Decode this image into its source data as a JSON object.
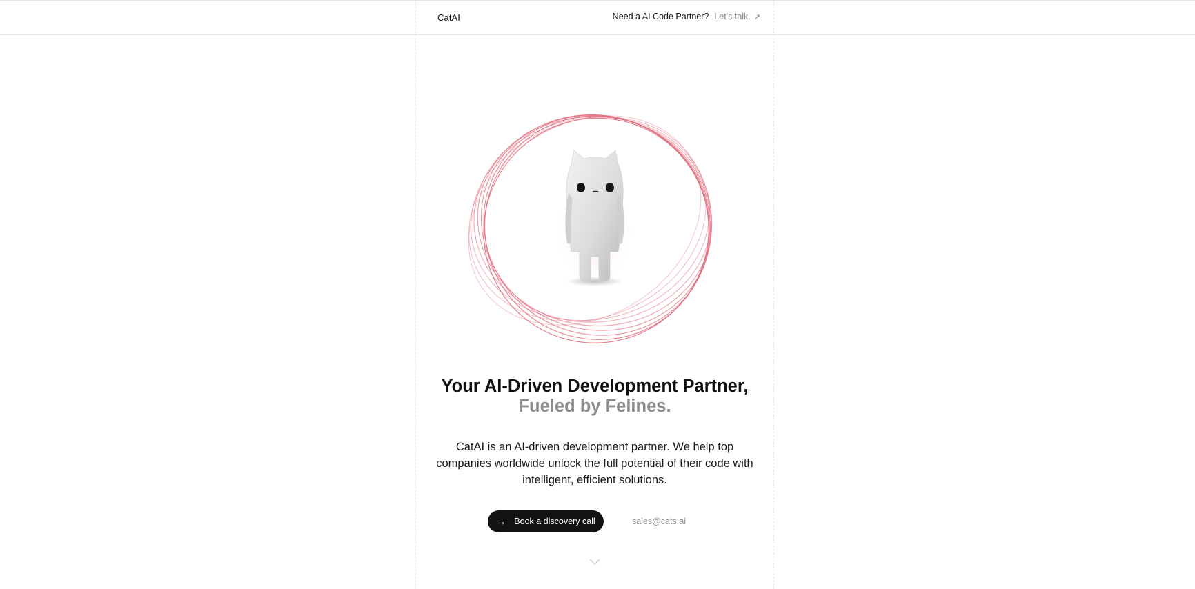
{
  "header": {
    "brand": "CatAI",
    "partner_question": "Need a AI Code Partner?",
    "partner_link": "Let's talk."
  },
  "hero": {
    "headline_main": "Your AI-Driven Development Partner,",
    "headline_accent": "Fueled by Felines.",
    "description": "CatAI is an AI-driven development partner. We help top companies worldwide unlock the full potential of their code with intelligent, efficient solutions.",
    "cta_label": "Book a discovery call",
    "cta_icon": "arrow-right-icon",
    "email": "sales@cats.ai"
  },
  "icons": {
    "external": "arrow-up-right-icon",
    "scroll": "chevron-down-icon",
    "mascot": "cat-mascot-illustration"
  },
  "colors": {
    "accent_ring": "#e06a7a",
    "button_bg": "#121212",
    "muted_text": "#8d8d8d"
  }
}
